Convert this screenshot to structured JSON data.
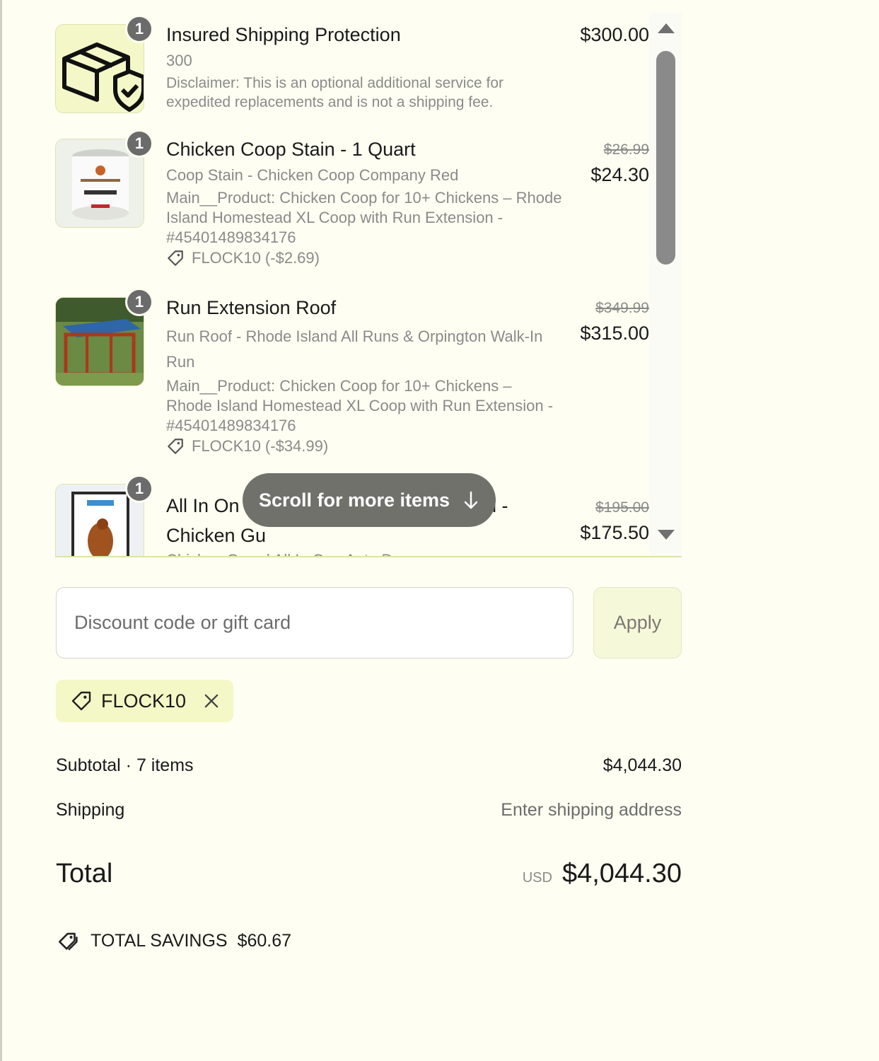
{
  "items": [
    {
      "qty": "1",
      "title": "Insured Shipping Protection",
      "variant": "300",
      "desc": "Disclaimer: This is an optional additional service for expedited replacements and is not a shipping fee.",
      "price": "$300.00"
    },
    {
      "qty": "1",
      "title": "Chicken Coop Stain - 1 Quart",
      "variant": "Coop Stain - Chicken Coop Company Red",
      "desc": "Main__Product: Chicken Coop for 10+ Chickens – Rhode Island Homestead XL Coop with Run Extension - #45401489834176",
      "discount": "FLOCK10 (-$2.69)",
      "original_price": "$26.99",
      "price": "$24.30"
    },
    {
      "qty": "1",
      "title": "Run Extension Roof",
      "variant": "Run Roof - Rhode Island All Runs & Orpington Walk-In Run",
      "desc": "Main__Product: Chicken Coop for 10+ Chickens – Rhode Island Homestead XL Coop with Run Extension - #45401489834176",
      "discount": "FLOCK10 (-$34.99)",
      "original_price": "$349.99",
      "price": "$315.00"
    },
    {
      "qty": "1",
      "title_a": "All In On",
      "title_b": "n -",
      "title_c": "Chicken Gu",
      "variant": "Chicken Guard All In One Auto Door",
      "original_price": "$195.00",
      "price": "$175.50"
    }
  ],
  "scroll_hint": "Scroll for more items",
  "discount": {
    "placeholder": "Discount code or gift card",
    "apply_label": "Apply",
    "applied_code": "FLOCK10"
  },
  "summary": {
    "subtotal_label": "Subtotal · 7 items",
    "subtotal_value": "$4,044.30",
    "shipping_label": "Shipping",
    "shipping_value": "Enter shipping address",
    "total_label": "Total",
    "currency": "USD",
    "total_value": "$4,044.30",
    "savings_label": "TOTAL SAVINGS",
    "savings_value": "$60.67"
  },
  "colors": {
    "background": "#fefff2",
    "accent_chip": "#f3f8c6",
    "scroll_pill": "#6f716a"
  }
}
